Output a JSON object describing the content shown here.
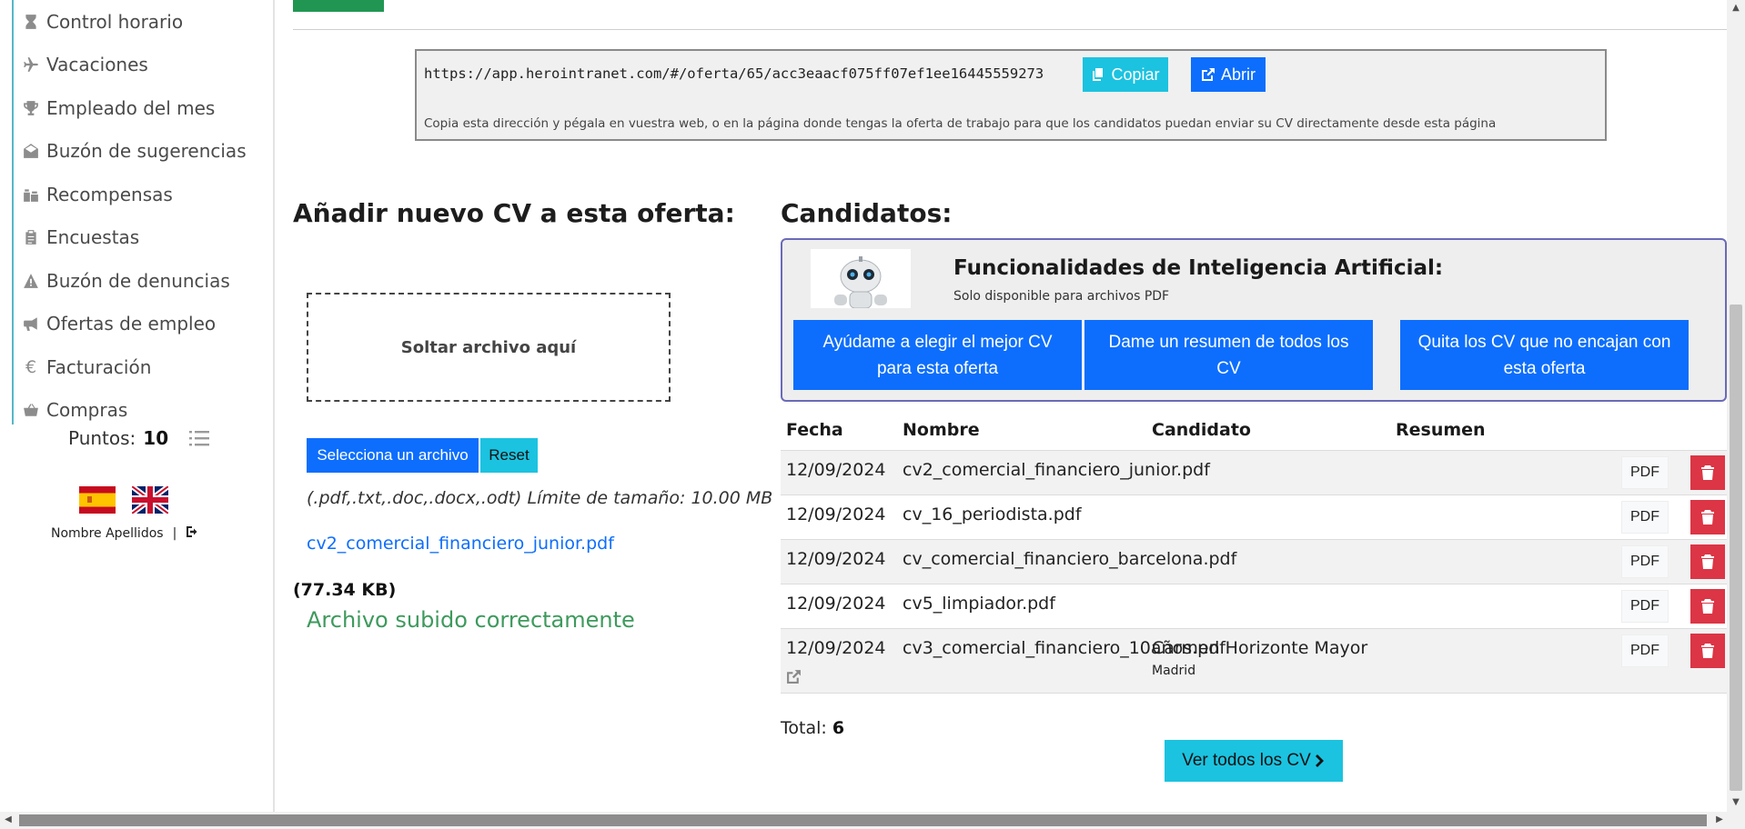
{
  "sidebar": {
    "items": [
      {
        "label": "Control horario",
        "icon": "hourglass-icon"
      },
      {
        "label": "Vacaciones",
        "icon": "plane-icon"
      },
      {
        "label": "Empleado del mes",
        "icon": "trophy-icon"
      },
      {
        "label": "Buzón de sugerencias",
        "icon": "envelope-open-icon"
      },
      {
        "label": "Recompensas",
        "icon": "gifts-icon"
      },
      {
        "label": "Encuestas",
        "icon": "clipboard-icon"
      },
      {
        "label": "Buzón de denuncias",
        "icon": "warning-icon"
      },
      {
        "label": "Ofertas de empleo",
        "icon": "megaphone-icon"
      },
      {
        "label": "Facturación",
        "icon": "euro-icon"
      },
      {
        "label": "Compras",
        "icon": "basket-icon"
      }
    ],
    "points_label": "Puntos:",
    "points_value": "10",
    "user_name": "Nombre Apellidos",
    "separator": "|"
  },
  "offer_link": {
    "url": "https://app.herointranet.com/#/oferta/65/acc3eaacf075ff07ef1ee16445559273",
    "copy_label": "Copiar",
    "open_label": "Abrir",
    "help_text": "Copia esta dirección y pégala en vuestra web, o en la página donde tengas la oferta de trabajo para que los candidatos puedan enviar su CV directamente desde esta página"
  },
  "upload": {
    "heading": "Añadir nuevo CV a esta oferta:",
    "dropzone_label": "Soltar archivo aquí",
    "select_label": "Selecciona un archivo",
    "reset_label": "Reset",
    "limits_text": "(.pdf,.txt,.doc,.docx,.odt) Límite de tamaño: 10.00 MB",
    "file_name": "cv2_comercial_financiero_junior.pdf",
    "file_size": "(77.34 KB)",
    "status": "Archivo subido correctamente"
  },
  "candidates": {
    "heading": "Candidatos:",
    "ai": {
      "title": "Funcionalidades de Inteligencia Artificial:",
      "subtitle": "Solo disponible para archivos PDF",
      "btn_best": "Ayúdame a elegir el mejor CV para esta oferta",
      "btn_summary": "Dame un resumen de todos los CV",
      "btn_filter": "Quita los CV que no encajan con esta oferta"
    },
    "columns": {
      "fecha": "Fecha",
      "nombre": "Nombre",
      "candidato": "Candidato",
      "resumen": "Resumen"
    },
    "rows": [
      {
        "fecha": "12/09/2024",
        "nombre": "cv2_comercial_financiero_junior.pdf",
        "candidato": "",
        "ubicacion": "",
        "pdf": "PDF"
      },
      {
        "fecha": "12/09/2024",
        "nombre": "cv_16_periodista.pdf",
        "candidato": "",
        "ubicacion": "",
        "pdf": "PDF"
      },
      {
        "fecha": "12/09/2024",
        "nombre": "cv_comercial_financiero_barcelona.pdf",
        "candidato": "",
        "ubicacion": "",
        "pdf": "PDF"
      },
      {
        "fecha": "12/09/2024",
        "nombre": "cv5_limpiador.pdf",
        "candidato": "",
        "ubicacion": "",
        "pdf": "PDF"
      },
      {
        "fecha": "12/09/2024",
        "nombre": "cv3_comercial_financiero_10años.pdf",
        "candidato": "Carmen Horizonte Mayor",
        "ubicacion": "Madrid",
        "pdf": "PDF"
      }
    ],
    "total_label": "Total:",
    "total_value": "6",
    "view_all_label": "Ver todos los CV"
  },
  "colors": {
    "primary": "#0d6efd",
    "info": "#1bc3e0",
    "danger": "#dc3545",
    "success_text": "#3e9a5d",
    "sidebar_accent": "#57b8c7"
  }
}
